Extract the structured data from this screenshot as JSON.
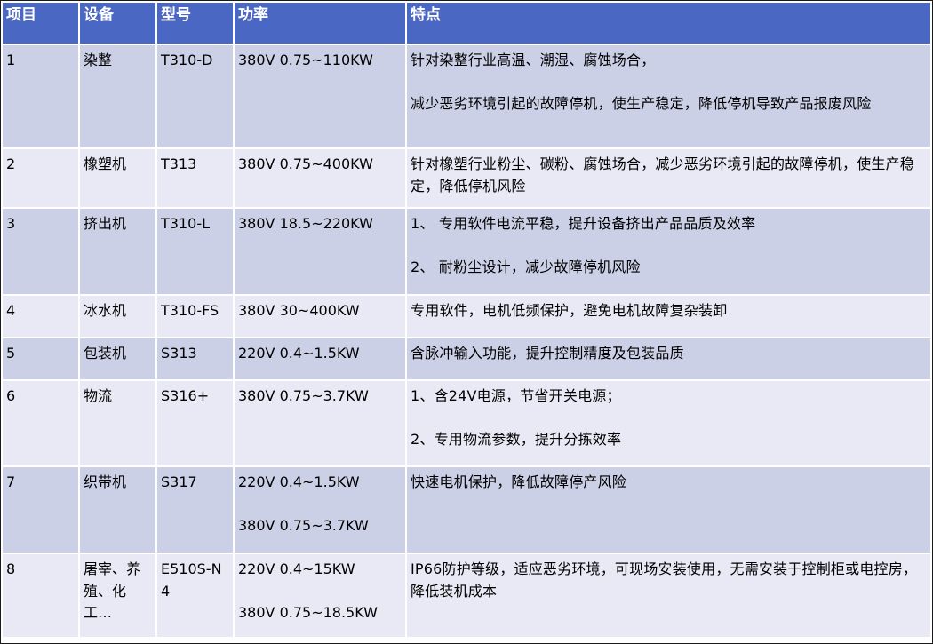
{
  "header": {
    "item": "项目",
    "device": "设备",
    "model": "型号",
    "power": "功率",
    "features": "特点"
  },
  "rows": [
    {
      "item": "1",
      "device": "染整",
      "model": "T310-D",
      "power": [
        "380V 0.75~110KW"
      ],
      "features": [
        "针对染整行业高温、潮湿、腐蚀场合，",
        "减少恶劣环境引起的故障停机，使生产稳定，降低停机导致产品报废风险"
      ]
    },
    {
      "item": "2",
      "device": "橡塑机",
      "model": "T313",
      "power": [
        "380V 0.75~400KW"
      ],
      "features": [
        "针对橡塑行业粉尘、碳粉、腐蚀场合，减少恶劣环境引起的故障停机，使生产稳定，降低停机风险"
      ]
    },
    {
      "item": "3",
      "device": "挤出机",
      "model": "T310-L",
      "power": [
        "380V 18.5~220KW"
      ],
      "features": [
        "1、 专用软件电流平稳，提升设备挤出产品品质及效率",
        "2、 耐粉尘设计，减少故障停机风险"
      ]
    },
    {
      "item": "4",
      "device": "冰水机",
      "model": "T310-FS",
      "power": [
        "380V 30~400KW"
      ],
      "features": [
        "专用软件，电机低频保护，避免电机故障复杂装卸"
      ]
    },
    {
      "item": "5",
      "device": "包装机",
      "model": "S313",
      "power": [
        "220V 0.4~1.5KW"
      ],
      "features": [
        "含脉冲输入功能，提升控制精度及包装品质"
      ]
    },
    {
      "item": "6",
      "device": "物流",
      "model": "S316+",
      "power": [
        "380V 0.75~3.7KW"
      ],
      "features": [
        "1、含24V电源，节省开关电源；",
        "2、专用物流参数，提升分拣效率"
      ]
    },
    {
      "item": "7",
      "device": "织带机",
      "model": "S317",
      "power": [
        "220V 0.4~1.5KW",
        "380V 0.75~3.7KW"
      ],
      "features": [
        "快速电机保护，降低故障停产风险"
      ]
    },
    {
      "item": "8",
      "device": "屠宰、养殖、化工…",
      "model": "E510S-N4",
      "power": [
        "220V 0.4~15KW",
        "380V 0.75~18.5KW"
      ],
      "features": [
        "IP66防护等级，适应恶劣环境，可现场安装使用，无需安装于控制柜或电控房，降低装机成本"
      ]
    }
  ]
}
